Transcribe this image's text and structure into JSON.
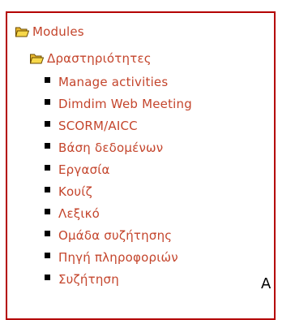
{
  "tree": {
    "root": {
      "label": "Modules",
      "icon": "folder-open-icon"
    },
    "category": {
      "label": "Δραστηριότητες",
      "icon": "folder-open-icon"
    },
    "items": [
      {
        "label": "Manage activities"
      },
      {
        "label": "Dimdim Web Meeting"
      },
      {
        "label": "SCORM/AICC"
      },
      {
        "label": "Βάση δεδομένων"
      },
      {
        "label": "Εργασία"
      },
      {
        "label": "Κουίζ"
      },
      {
        "label": "Λεξικό"
      },
      {
        "label": "Ομάδα συζήτησης"
      },
      {
        "label": "Πηγή πληροφοριών"
      },
      {
        "label": "Συζήτηση"
      }
    ]
  },
  "stray_char": "A",
  "colors": {
    "border": "#b40000",
    "link": "#c4452c",
    "folder": "#e8b830"
  }
}
